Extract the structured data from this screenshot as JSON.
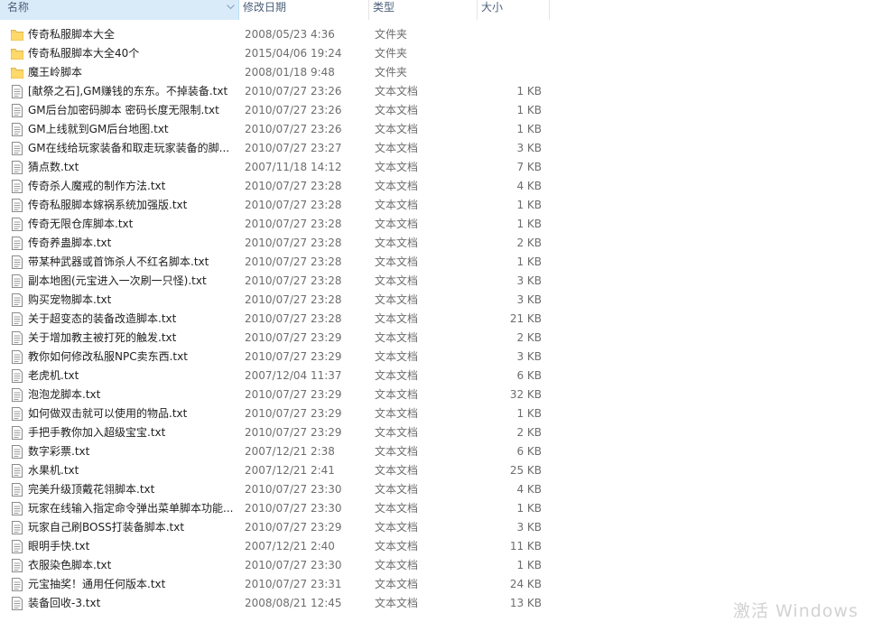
{
  "columns": {
    "name": "名称",
    "date": "修改日期",
    "type": "类型",
    "size": "大小"
  },
  "files": [
    {
      "name": "传奇私服脚本大全",
      "date": "2008/05/23 4:36",
      "type": "文件夹",
      "size": "",
      "icon": "folder-icon"
    },
    {
      "name": "传奇私服脚本大全40个",
      "date": "2015/04/06 19:24",
      "type": "文件夹",
      "size": "",
      "icon": "folder-icon"
    },
    {
      "name": "魔王岭脚本",
      "date": "2008/01/18 9:48",
      "type": "文件夹",
      "size": "",
      "icon": "folder-icon"
    },
    {
      "name": "[献祭之石],GM赚钱的东东。不掉装备.txt",
      "date": "2010/07/27 23:26",
      "type": "文本文档",
      "size": "1 KB",
      "icon": "text-file-icon"
    },
    {
      "name": "GM后台加密码脚本 密码长度无限制.txt",
      "date": "2010/07/27 23:26",
      "type": "文本文档",
      "size": "1 KB",
      "icon": "text-file-icon"
    },
    {
      "name": "GM上线就到GM后台地图.txt",
      "date": "2010/07/27 23:26",
      "type": "文本文档",
      "size": "1 KB",
      "icon": "text-file-icon"
    },
    {
      "name": "GM在线给玩家装备和取走玩家装备的脚...",
      "date": "2010/07/27 23:27",
      "type": "文本文档",
      "size": "3 KB",
      "icon": "text-file-icon"
    },
    {
      "name": "猜点数.txt",
      "date": "2007/11/18 14:12",
      "type": "文本文档",
      "size": "7 KB",
      "icon": "text-file-icon"
    },
    {
      "name": "传奇杀人魔戒的制作方法.txt",
      "date": "2010/07/27 23:28",
      "type": "文本文档",
      "size": "4 KB",
      "icon": "text-file-icon"
    },
    {
      "name": "传奇私服脚本嫁祸系统加强版.txt",
      "date": "2010/07/27 23:28",
      "type": "文本文档",
      "size": "1 KB",
      "icon": "text-file-icon"
    },
    {
      "name": "传奇无限仓库脚本.txt",
      "date": "2010/07/27 23:28",
      "type": "文本文档",
      "size": "1 KB",
      "icon": "text-file-icon"
    },
    {
      "name": "传奇养蛊脚本.txt",
      "date": "2010/07/27 23:28",
      "type": "文本文档",
      "size": "2 KB",
      "icon": "text-file-icon"
    },
    {
      "name": "带某种武器或首饰杀人不红名脚本.txt",
      "date": "2010/07/27 23:28",
      "type": "文本文档",
      "size": "1 KB",
      "icon": "text-file-icon"
    },
    {
      "name": "副本地图(元宝进入一次刷一只怪).txt",
      "date": "2010/07/27 23:28",
      "type": "文本文档",
      "size": "3 KB",
      "icon": "text-file-icon"
    },
    {
      "name": "购买宠物脚本.txt",
      "date": "2010/07/27 23:28",
      "type": "文本文档",
      "size": "3 KB",
      "icon": "text-file-icon"
    },
    {
      "name": "关于超变态的装备改造脚本.txt",
      "date": "2010/07/27 23:28",
      "type": "文本文档",
      "size": "21 KB",
      "icon": "text-file-icon"
    },
    {
      "name": "关于增加教主被打死的触发.txt",
      "date": "2010/07/27 23:29",
      "type": "文本文档",
      "size": "2 KB",
      "icon": "text-file-icon"
    },
    {
      "name": "教你如何修改私服NPC卖东西.txt",
      "date": "2010/07/27 23:29",
      "type": "文本文档",
      "size": "3 KB",
      "icon": "text-file-icon"
    },
    {
      "name": "老虎机.txt",
      "date": "2007/12/04 11:37",
      "type": "文本文档",
      "size": "6 KB",
      "icon": "text-file-icon"
    },
    {
      "name": "泡泡龙脚本.txt",
      "date": "2010/07/27 23:29",
      "type": "文本文档",
      "size": "32 KB",
      "icon": "text-file-icon"
    },
    {
      "name": "如何做双击就可以使用的物品.txt",
      "date": "2010/07/27 23:29",
      "type": "文本文档",
      "size": "1 KB",
      "icon": "text-file-icon"
    },
    {
      "name": "手把手教你加入超级宝宝.txt",
      "date": "2010/07/27 23:29",
      "type": "文本文档",
      "size": "2 KB",
      "icon": "text-file-icon"
    },
    {
      "name": "数字彩票.txt",
      "date": "2007/12/21 2:38",
      "type": "文本文档",
      "size": "6 KB",
      "icon": "text-file-icon"
    },
    {
      "name": "水果机.txt",
      "date": "2007/12/21 2:41",
      "type": "文本文档",
      "size": "25 KB",
      "icon": "text-file-icon"
    },
    {
      "name": "完美升级顶戴花翎脚本.txt",
      "date": "2010/07/27 23:30",
      "type": "文本文档",
      "size": "4 KB",
      "icon": "text-file-icon"
    },
    {
      "name": "玩家在线输入指定命令弹出菜单脚本功能...",
      "date": "2010/07/27 23:30",
      "type": "文本文档",
      "size": "1 KB",
      "icon": "text-file-icon"
    },
    {
      "name": "玩家自己刷BOSS打装备脚本.txt",
      "date": "2010/07/27 23:29",
      "type": "文本文档",
      "size": "3 KB",
      "icon": "text-file-icon"
    },
    {
      "name": "眼明手快.txt",
      "date": "2007/12/21 2:40",
      "type": "文本文档",
      "size": "11 KB",
      "icon": "text-file-icon"
    },
    {
      "name": "衣服染色脚本.txt",
      "date": "2010/07/27 23:30",
      "type": "文本文档",
      "size": "1 KB",
      "icon": "text-file-icon"
    },
    {
      "name": "元宝抽奖！通用任何版本.txt",
      "date": "2010/07/27 23:31",
      "type": "文本文档",
      "size": "24 KB",
      "icon": "text-file-icon"
    },
    {
      "name": "装备回收-3.txt",
      "date": "2008/08/21 12:45",
      "type": "文本文档",
      "size": "13 KB",
      "icon": "text-file-icon"
    }
  ],
  "watermark": "激活 Windows"
}
